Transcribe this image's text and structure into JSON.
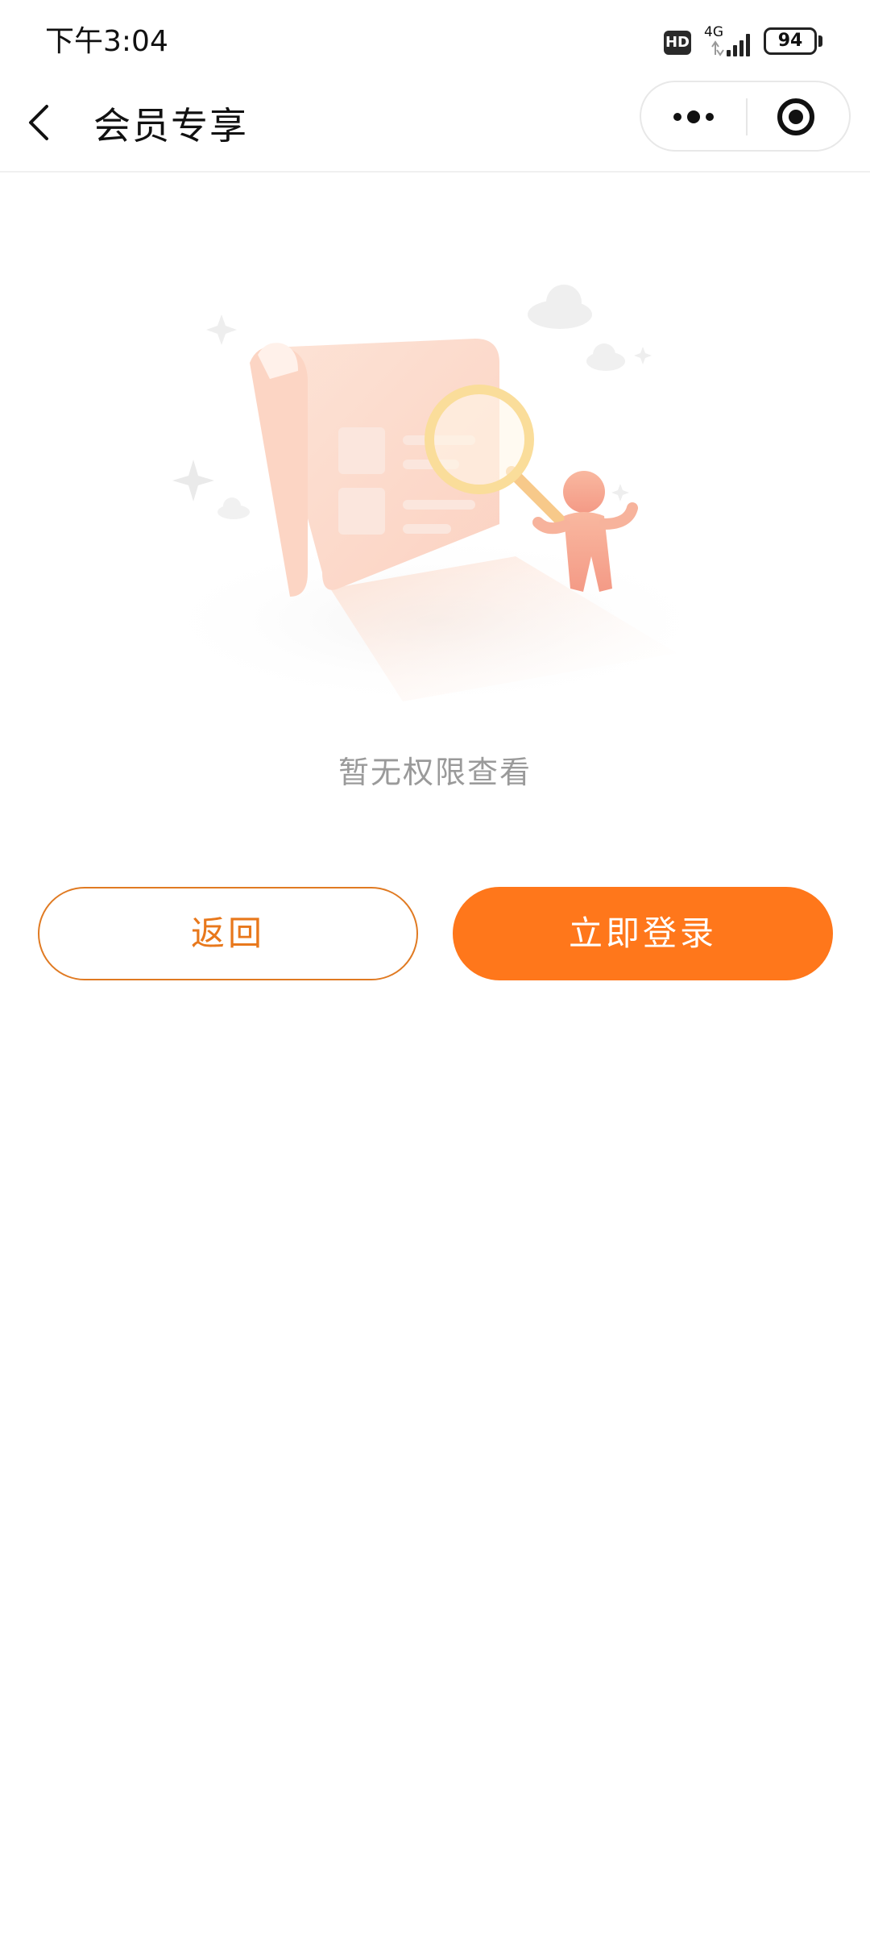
{
  "status_bar": {
    "time": "下午3:04",
    "hd_badge": "HD",
    "network": "4G",
    "battery": "94"
  },
  "nav": {
    "title": "会员专享",
    "back_icon": "chevron-left-icon",
    "more_icon": "more-dots-icon",
    "close_icon": "target-close-icon"
  },
  "empty_state": {
    "illustration": "magnifier-document-illustration",
    "message": "暂无权限查看"
  },
  "actions": {
    "back_label": "返回",
    "login_label": "立即登录"
  },
  "colors": {
    "accent": "#ff771b",
    "outline": "#e07a22",
    "muted_text": "#9a9a9a"
  }
}
